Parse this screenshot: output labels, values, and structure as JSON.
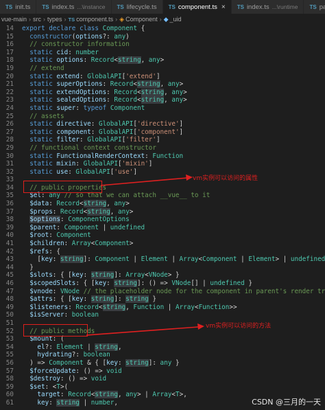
{
  "tabs": [
    {
      "name": "init.ts",
      "hint": "",
      "active": false
    },
    {
      "name": "index.ts",
      "hint": "...\\instance",
      "active": false
    },
    {
      "name": "lifecycle.ts",
      "hint": "",
      "active": false
    },
    {
      "name": "component.ts",
      "hint": "",
      "active": true
    },
    {
      "name": "index.ts",
      "hint": "...\\runtime",
      "active": false
    },
    {
      "name": "patch.ts",
      "hint": "",
      "active": false
    }
  ],
  "tab_icon": "TS",
  "close_glyph": "×",
  "breadcrumb": {
    "items": [
      "vue-main",
      "src",
      "types"
    ],
    "file": "component.ts",
    "cls": "Component",
    "prop": "_uid"
  },
  "lines": [
    {
      "n": "14",
      "html": "<span class='k'>export</span> <span class='k'>declare</span> <span class='k'>class</span> <span class='t'>Component</span> {"
    },
    {
      "n": "15",
      "html": "  <span class='k'>constructor</span>(<span class='p'>options</span>?: <span class='t'>any</span>)"
    },
    {
      "n": "16",
      "html": "  <span class='c'>// constructor information</span>"
    },
    {
      "n": "17",
      "html": "  <span class='k'>static</span> <span class='p'>cid</span>: <span class='t'>number</span>"
    },
    {
      "n": "18",
      "html": "  <span class='k'>static</span> <span class='p'>options</span>: <span class='t'>Record</span>&lt;<span class='h'>string</span>, <span class='t'>any</span>&gt;"
    },
    {
      "n": "19",
      "html": "  <span class='c'>// extend</span>"
    },
    {
      "n": "20",
      "html": "  <span class='k'>static</span> <span class='p'>extend</span>: <span class='t'>GlobalAPI</span>[<span class='s'>'extend'</span>]"
    },
    {
      "n": "21",
      "html": "  <span class='k'>static</span> <span class='p'>superOptions</span>: <span class='t'>Record</span>&lt;<span class='h'>string</span>, <span class='t'>any</span>&gt;"
    },
    {
      "n": "22",
      "html": "  <span class='k'>static</span> <span class='p'>extendOptions</span>: <span class='t'>Record</span>&lt;<span class='h'>string</span>, <span class='t'>any</span>&gt;"
    },
    {
      "n": "23",
      "html": "  <span class='k'>static</span> <span class='p'>sealedOptions</span>: <span class='t'>Record</span>&lt;<span class='h'>string</span>, <span class='t'>any</span>&gt;"
    },
    {
      "n": "24",
      "html": "  <span class='k'>static</span> <span class='p'>super</span>: <span class='k'>typeof</span> <span class='t'>Component</span>"
    },
    {
      "n": "25",
      "html": "  <span class='c'>// assets</span>"
    },
    {
      "n": "26",
      "html": "  <span class='k'>static</span> <span class='p'>directive</span>: <span class='t'>GlobalAPI</span>[<span class='s'>'directive'</span>]"
    },
    {
      "n": "27",
      "html": "  <span class='k'>static</span> <span class='p'>component</span>: <span class='t'>GlobalAPI</span>[<span class='s'>'component'</span>]"
    },
    {
      "n": "28",
      "html": "  <span class='k'>static</span> <span class='p'>filter</span>: <span class='t'>GlobalAPI</span>[<span class='s'>'filter'</span>]"
    },
    {
      "n": "29",
      "html": "  <span class='c'>// functional context constructor</span>"
    },
    {
      "n": "30",
      "html": "  <span class='k'>static</span> <span class='p'>FunctionalRenderContext</span>: <span class='t'>Function</span>"
    },
    {
      "n": "31",
      "html": "  <span class='k'>static</span> <span class='p'>mixin</span>: <span class='t'>GlobalAPI</span>[<span class='s'>'mixin'</span>]"
    },
    {
      "n": "32",
      "html": "  <span class='k'>static</span> <span class='p'>use</span>: <span class='t'>GlobalAPI</span>[<span class='s'>'use'</span>]"
    },
    {
      "n": "33",
      "html": ""
    },
    {
      "n": "34",
      "html": "  <span class='c'>// public properties</span>"
    },
    {
      "n": "35",
      "html": "  <span class='p'>$el</span>: <span class='t'>any</span> <span class='c'>// so that we can attach __vue__ to it</span>"
    },
    {
      "n": "36",
      "html": "  <span class='p'>$data</span>: <span class='t'>Record</span>&lt;<span class='h'>string</span>, <span class='t'>any</span>&gt;"
    },
    {
      "n": "37",
      "html": "  <span class='p'>$props</span>: <span class='t'>Record</span>&lt;<span class='h'>string</span>, <span class='t'>any</span>&gt;"
    },
    {
      "n": "38",
      "html": "  <span class='hp'>$options</span>: <span class='t'>ComponentOptions</span>"
    },
    {
      "n": "39",
      "html": "  <span class='p'>$parent</span>: <span class='t'>Component</span> | <span class='t'>undefined</span>"
    },
    {
      "n": "40",
      "html": "  <span class='p'>$root</span>: <span class='t'>Component</span>"
    },
    {
      "n": "41",
      "html": "  <span class='p'>$children</span>: <span class='t'>Array</span>&lt;<span class='t'>Component</span>&gt;"
    },
    {
      "n": "42",
      "html": "  <span class='p'>$refs</span>: {"
    },
    {
      "n": "43",
      "html": "    [<span class='p'>key</span>: <span class='h'>string</span>]: <span class='t'>Component</span> | <span class='t'>Element</span> | <span class='t'>Array</span>&lt;<span class='t'>Component</span> | <span class='t'>Element</span>&gt; | <span class='t'>undefined</span>"
    },
    {
      "n": "44",
      "html": "  }"
    },
    {
      "n": "45",
      "html": "  <span class='p'>$slots</span>: { [<span class='p'>key</span>: <span class='h'>string</span>]: <span class='t'>Array</span>&lt;<span class='t'>VNode</span>&gt; }"
    },
    {
      "n": "46",
      "html": "  <span class='p'>$scopedSlots</span>: { [<span class='p'>key</span>: <span class='h'>string</span>]: () =&gt; <span class='t'>VNode</span>[] | <span class='t'>undefined</span> }"
    },
    {
      "n": "47",
      "html": "  <span class='p'>$vnode</span>: <span class='t'>VNode</span> <span class='c'>// the placeholder node for the component in parent's render tree</span>"
    },
    {
      "n": "48",
      "html": "  <span class='p'>$attrs</span>: { [<span class='p'>key</span>: <span class='h'>string</span>]: <span class='h'>string</span> }"
    },
    {
      "n": "49",
      "html": "  <span class='p'>$listeners</span>: <span class='t'>Record</span>&lt;<span class='h'>string</span>, <span class='t'>Function</span> | <span class='t'>Array</span>&lt;<span class='t'>Function</span>&gt;&gt;"
    },
    {
      "n": "50",
      "html": "  <span class='p'>$isServer</span>: <span class='t'>boolean</span>"
    },
    {
      "n": "51",
      "html": ""
    },
    {
      "n": "52",
      "html": "  <span class='c'>// public methods</span>"
    },
    {
      "n": "53",
      "html": "  <span class='p'>$mount</span>: ("
    },
    {
      "n": "54",
      "html": "    <span class='p'>el</span>?: <span class='t'>Element</span> | <span class='h'>string</span>,"
    },
    {
      "n": "55",
      "html": "    <span class='p'>hydrating</span>?: <span class='t'>boolean</span>"
    },
    {
      "n": "56",
      "html": "  ) =&gt; <span class='t'>Component</span> &amp; { [<span class='p'>key</span>: <span class='h'>string</span>]: <span class='t'>any</span> }"
    },
    {
      "n": "57",
      "html": "  <span class='p'>$forceUpdate</span>: () =&gt; <span class='t'>void</span>"
    },
    {
      "n": "58",
      "html": "  <span class='p'>$destroy</span>: () =&gt; <span class='t'>void</span>"
    },
    {
      "n": "59",
      "html": "  <span class='p'>$set</span>: &lt;<span class='t'>T</span>&gt;("
    },
    {
      "n": "60",
      "html": "    <span class='p'>target</span>: <span class='t'>Record</span>&lt;<span class='h'>string</span>, <span class='t'>any</span>&gt; | <span class='t'>Array</span>&lt;<span class='t'>T</span>&gt;,"
    },
    {
      "n": "61",
      "html": "    <span class='p'>key</span>: <span class='h'>string</span> | <span class='t'>number</span>,"
    }
  ],
  "annotations": [
    {
      "text": "vm实例可以访问的属性"
    },
    {
      "text": "vm实例可以访问的方法"
    }
  ],
  "watermark": "CSDN @三月的一天"
}
